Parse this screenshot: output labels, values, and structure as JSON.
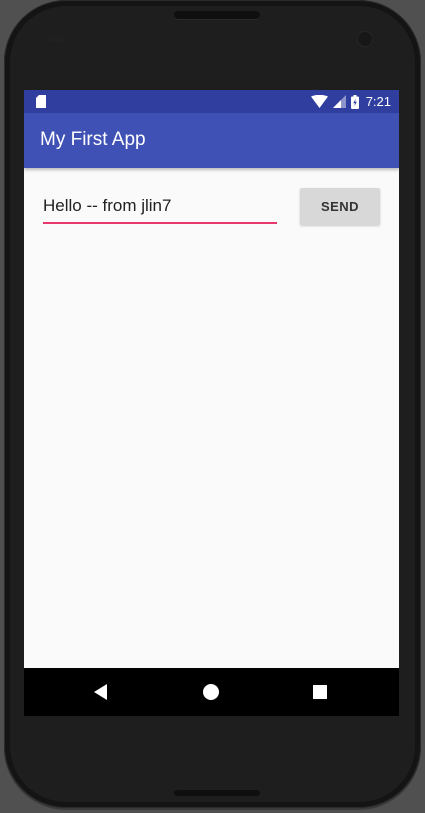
{
  "status_bar": {
    "time": "7:21",
    "background": "#303F9F",
    "left_icon": "sd-card-icon",
    "right_icons": [
      "wifi-icon",
      "signal-icon",
      "battery-icon"
    ]
  },
  "app_bar": {
    "title": "My First App",
    "background": "#3F51B5"
  },
  "main": {
    "message_input": {
      "value": "Hello -- from jlin7",
      "underline_color": "#E8386B"
    },
    "send_button": {
      "label": "SEND"
    }
  },
  "nav_bar": {
    "icons": [
      "back-icon",
      "home-icon",
      "recents-icon"
    ]
  },
  "colors": {
    "primary": "#3F51B5",
    "primary_dark": "#303F9F",
    "accent": "#E8386B",
    "window_background": "#FAFAFA"
  }
}
